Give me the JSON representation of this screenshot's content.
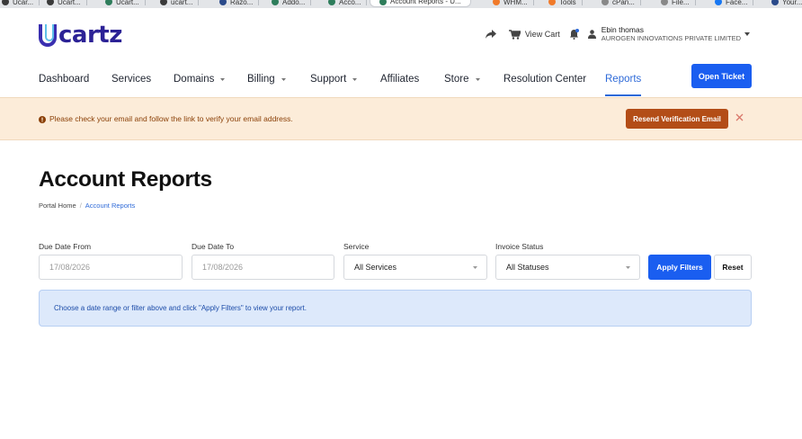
{
  "browser": {
    "tabs": [
      {
        "label": "Ucar...",
        "color": "#3a3a3a",
        "active": false
      },
      {
        "label": "Ucart...",
        "color": "#3a3a3a",
        "active": false
      },
      {
        "label": "Ucart...",
        "color": "#2e7d5b",
        "active": false
      },
      {
        "label": "ucart...",
        "color": "#3a3a3a",
        "active": false
      },
      {
        "label": "Razo...",
        "color": "#2a4a8a",
        "active": false
      },
      {
        "label": "Addo...",
        "color": "#2e7d5b",
        "active": false
      },
      {
        "label": "Acco...",
        "color": "#2e7d5b",
        "active": false
      },
      {
        "label": "Account Reports - U...",
        "color": "#2e7d5b",
        "active": true
      },
      {
        "label": "WHM...",
        "color": "#f07a2a",
        "active": false
      },
      {
        "label": "Tools",
        "color": "#f07a2a",
        "active": false
      },
      {
        "label": "cPan...",
        "color": "#888888",
        "active": false
      },
      {
        "label": "File...",
        "color": "#888888",
        "active": false
      },
      {
        "label": "Face...",
        "color": "#1877f2",
        "active": false
      },
      {
        "label": "Your...",
        "color": "#2a4a8a",
        "active": false
      }
    ]
  },
  "header": {
    "logo_text": "cartz",
    "logo_colors": {
      "primary": "#2c2296",
      "accent": "#5ec1e8"
    },
    "cart_label": "View Cart",
    "user_name": "Ebin thomas",
    "user_company": "AUROGEN INNOVATIONS PRIVATE LIMITED"
  },
  "nav": {
    "items": [
      {
        "label": "Dashboard",
        "dropdown": false
      },
      {
        "label": "Services",
        "dropdown": false
      },
      {
        "label": "Domains",
        "dropdown": true
      },
      {
        "label": "Billing",
        "dropdown": true
      },
      {
        "label": "Support",
        "dropdown": true
      },
      {
        "label": "Affiliates",
        "dropdown": false
      },
      {
        "label": "Store",
        "dropdown": true
      },
      {
        "label": "Resolution Center",
        "dropdown": false
      },
      {
        "label": "Reports",
        "dropdown": false,
        "active": true
      }
    ],
    "open_ticket_label": "Open Ticket",
    "accent_color": "#1a5ef0"
  },
  "alert": {
    "message": "Please check your email and follow the link to verify your email address.",
    "button_label": "Resend Verification Email",
    "background": "#fcecd9",
    "button_color": "#b34d17"
  },
  "page": {
    "title": "Account Reports",
    "breadcrumb": {
      "home": "Portal Home",
      "separator": "/",
      "current": "Account Reports"
    }
  },
  "filters": {
    "due_from_label": "Due Date From",
    "due_from_value": "17/08/2026",
    "due_to_label": "Due Date To",
    "due_to_value": "17/08/2026",
    "service_label": "Service",
    "service_value": "All Services",
    "status_label": "Invoice Status",
    "status_value": "All Statuses",
    "apply_label": "Apply Filters",
    "reset_label": "Reset"
  },
  "info": {
    "message": "Choose a date range or filter above and click \"Apply Filters\" to view your report."
  }
}
